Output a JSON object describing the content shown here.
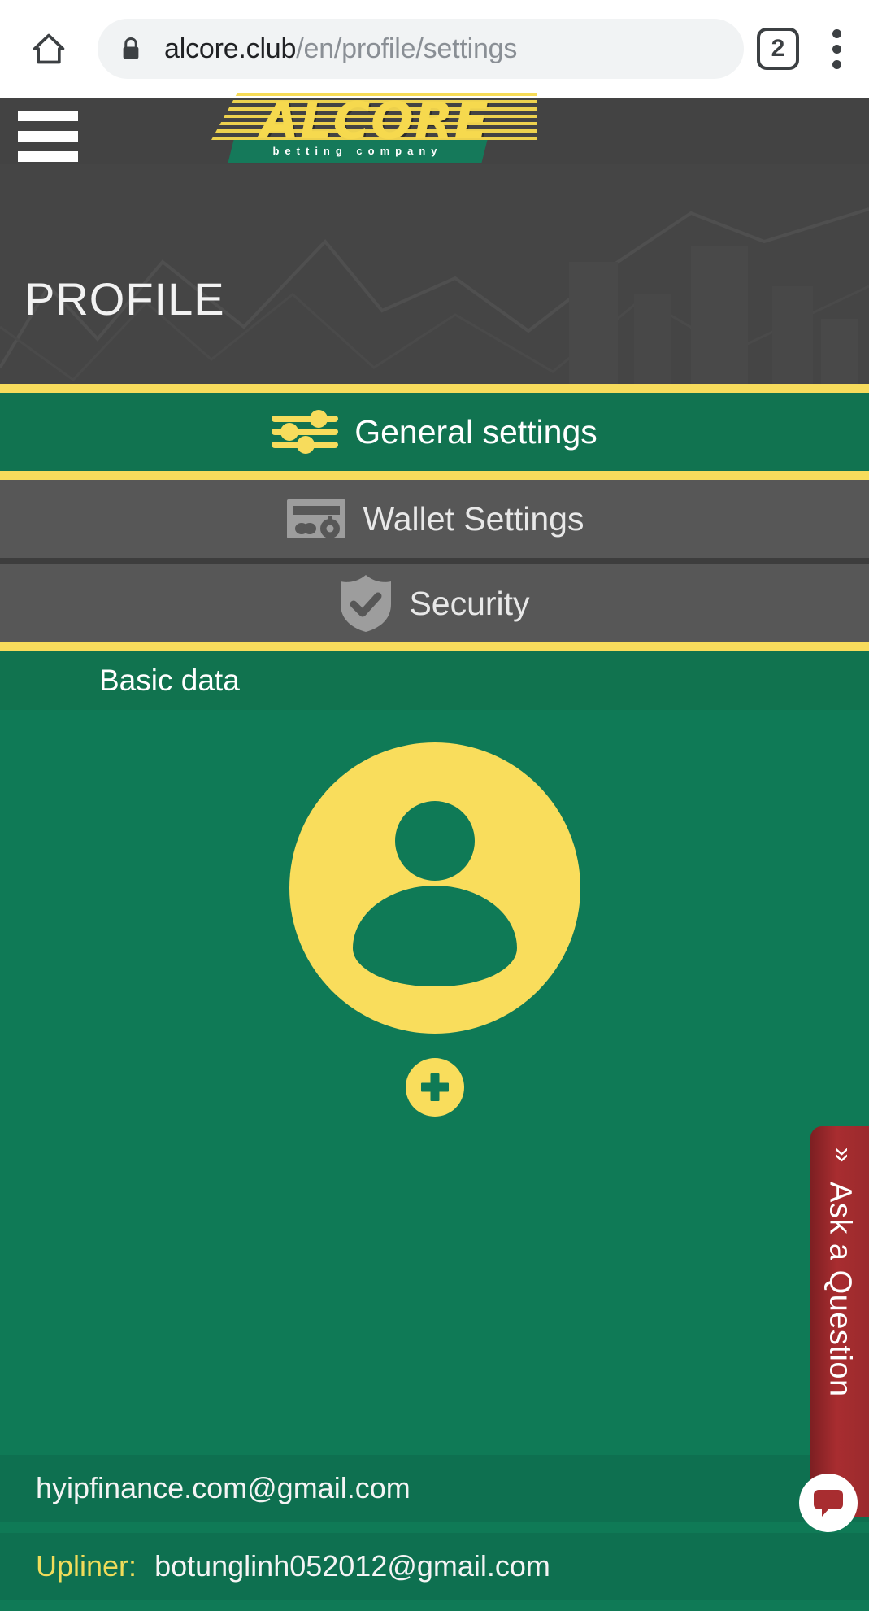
{
  "browser": {
    "home_icon": "home-icon",
    "lock_icon": "lock-icon",
    "url_domain": "alcore.club",
    "url_path": "/en/profile/settings",
    "tab_count": "2",
    "menu_icon": "kebab-menu-icon"
  },
  "site": {
    "menu_icon": "hamburger-menu-icon",
    "logo_word": "ALCORE",
    "logo_tagline": "betting company"
  },
  "hero": {
    "title": "PROFILE"
  },
  "tabs": [
    {
      "label": "General settings",
      "icon": "sliders-icon",
      "active": true
    },
    {
      "label": "Wallet Settings",
      "icon": "credit-card-gear-icon",
      "active": false
    },
    {
      "label": "Security",
      "icon": "shield-check-icon",
      "active": false
    }
  ],
  "basic_data": {
    "section_title": "Basic data",
    "avatar_icon": "user-avatar-icon",
    "add_photo_icon": "plus-icon",
    "email": "hyipfinance.com@gmail.com",
    "upliner_label": "Upliner:",
    "upliner_email": "botunglinh052012@gmail.com"
  },
  "support_widget": {
    "collapse_icon": "double-chevron-left-icon",
    "label": "Ask a Question",
    "chat_icon": "chat-bubble-icon"
  },
  "colors": {
    "green": "#0f7a56",
    "green_dark": "#117350",
    "yellow": "#f7dc5c",
    "gray_dark": "#434343",
    "gray_tab": "#575757",
    "red": "#a82d30"
  }
}
